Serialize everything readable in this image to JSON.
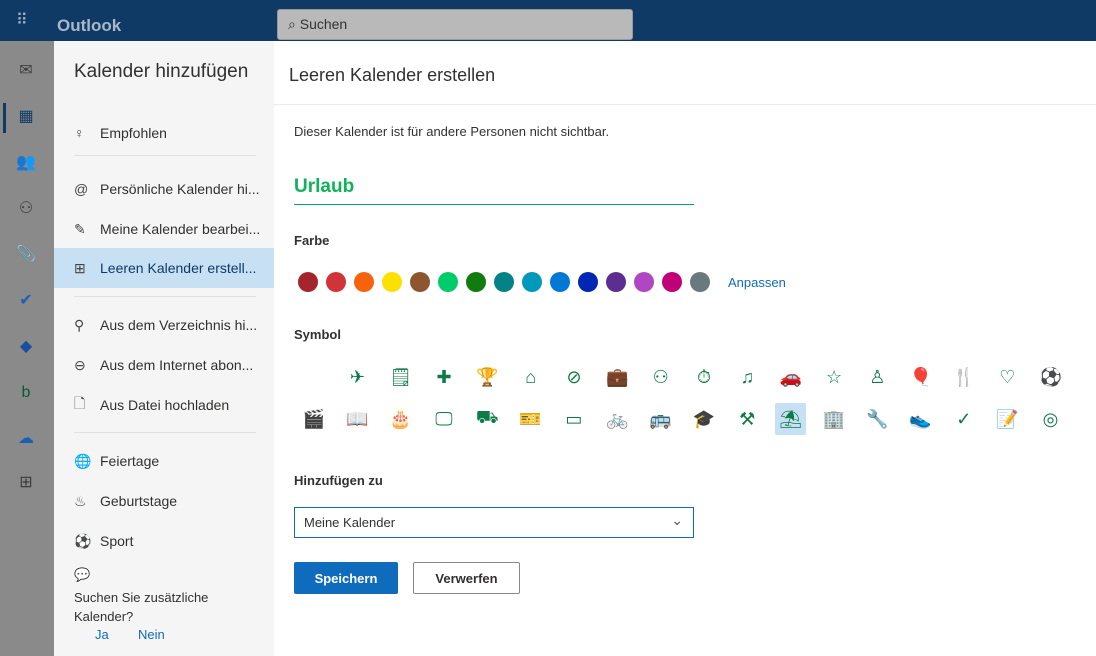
{
  "app": {
    "title": "Outlook",
    "search_placeholder": "Suchen"
  },
  "panel": {
    "title": "Kalender hinzufügen",
    "items": [
      {
        "label": "Empfohlen",
        "icon": "lightbulb-icon"
      },
      {
        "label": "Persönliche Kalender hi...",
        "icon": "at-icon"
      },
      {
        "label": "Meine Kalender bearbei...",
        "icon": "edit-calendar-icon"
      },
      {
        "label": "Leeren Kalender erstell...",
        "icon": "calendar-add-icon",
        "active": true
      },
      {
        "label": "Aus dem Verzeichnis hi...",
        "icon": "people-search-icon"
      },
      {
        "label": "Aus dem Internet abon...",
        "icon": "link-icon"
      },
      {
        "label": "Aus Datei hochladen",
        "icon": "file-upload-icon"
      },
      {
        "label": "Feiertage",
        "icon": "globe-icon"
      },
      {
        "label": "Geburtstage",
        "icon": "cake-icon"
      },
      {
        "label": "Sport",
        "icon": "ball-icon"
      }
    ],
    "feedback": {
      "question": "Suchen Sie zusätzliche Kalender?",
      "yes": "Ja",
      "no": "Nein"
    }
  },
  "main": {
    "title": "Leeren Kalender erstellen",
    "description": "Dieser Kalender ist für andere Personen nicht sichtbar.",
    "name_value": "Urlaub",
    "color_label": "Farbe",
    "colors": [
      "#a4262c",
      "#d13438",
      "#f7630c",
      "#fce100",
      "#8e562e",
      "#00cc6a",
      "#107c10",
      "#038387",
      "#0099bc",
      "#0078d4",
      "#0027b4",
      "#5c2e91",
      "#b146c2",
      "#bf0077",
      "#69797e"
    ],
    "selected_color": "#10b35b",
    "customize_label": "Anpassen",
    "symbol_label": "Symbol",
    "symbols_row1": [
      "airplane",
      "notepad",
      "first-aid",
      "trophy",
      "home",
      "bandage",
      "briefcase",
      "people",
      "stopwatch",
      "music",
      "car",
      "star",
      "person",
      "balloons",
      "food",
      "heart",
      "soccer"
    ],
    "symbols_row2": [
      "clapperboard",
      "book",
      "cake",
      "monitor",
      "truck",
      "ticket",
      "credit-card",
      "cyclist",
      "bus",
      "graduation-cap",
      "dumbbell",
      "beach",
      "building",
      "wrench",
      "shoe",
      "checkmark",
      "notes",
      "target"
    ],
    "selected_symbol": "beach",
    "add_to_label": "Hinzufügen zu",
    "add_to_value": "Meine Kalender",
    "save": "Speichern",
    "discard": "Verwerfen"
  }
}
